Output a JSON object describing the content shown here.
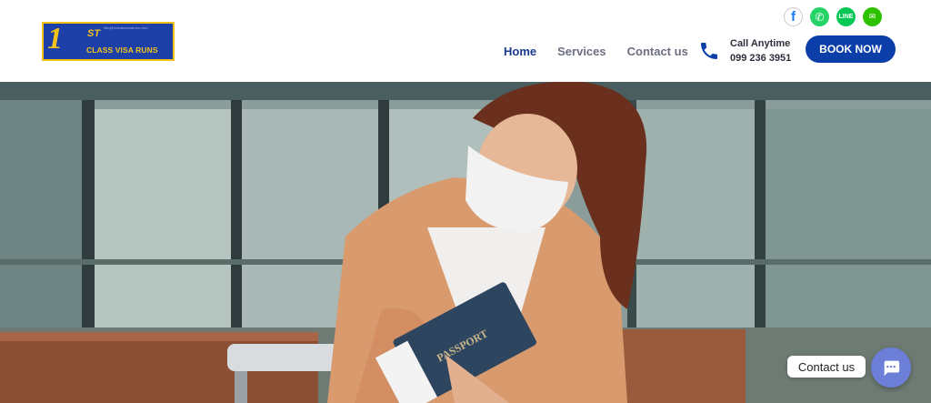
{
  "logo": {
    "number": "1",
    "superscript": "ST",
    "name": "CLASS VISA RUNS",
    "email": "info@1stclassvisaruns.com"
  },
  "social": [
    {
      "name": "facebook-icon",
      "glyph": "f"
    },
    {
      "name": "whatsapp-icon",
      "glyph": "✆"
    },
    {
      "name": "line-icon",
      "glyph": "LINE"
    },
    {
      "name": "wechat-icon",
      "glyph": "✉"
    }
  ],
  "nav": {
    "home": "Home",
    "services": "Services",
    "contact": "Contact us"
  },
  "call": {
    "label": "Call Anytime",
    "number": "099 236 3951"
  },
  "book_button": "BOOK NOW",
  "hero": {
    "passport_text": "PASSPORT"
  },
  "chat": {
    "label": "Contact us"
  },
  "colors": {
    "brand_blue": "#0b3ea8",
    "nav_active": "#1a3a8f",
    "chat_button": "#6b7fd9"
  }
}
